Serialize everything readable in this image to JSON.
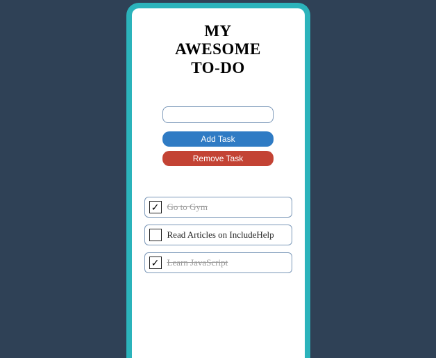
{
  "title": {
    "line1": "MY",
    "line2": "AWESOME",
    "line3": "TO-DO"
  },
  "input": {
    "value": "",
    "placeholder": ""
  },
  "buttons": {
    "add": "Add Task",
    "remove": "Remove Task"
  },
  "tasks": [
    {
      "label": "Go to Gym",
      "done": true
    },
    {
      "label": "Read Articles on IncludeHelp",
      "done": false
    },
    {
      "label": "Learn JavaScript",
      "done": true
    }
  ],
  "colors": {
    "page_bg": "#2f4156",
    "frame_border": "#2bb3bb",
    "btn_add": "#2f7bc4",
    "btn_remove": "#c34334",
    "field_border": "#7a97b8"
  },
  "checkmark_glyph": "✓"
}
